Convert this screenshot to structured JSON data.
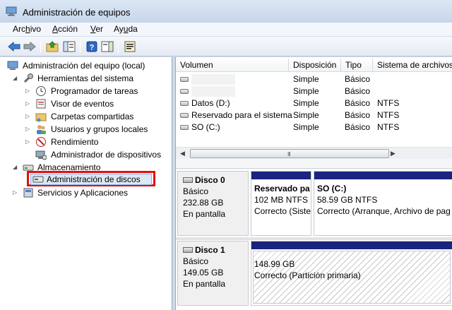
{
  "window": {
    "title": "Administración de equipos"
  },
  "menu": [
    {
      "label": "Archivo",
      "pre": "Arc",
      "u": "h",
      "post": "ivo"
    },
    {
      "label": "Acción",
      "pre": "",
      "u": "A",
      "post": "cción"
    },
    {
      "label": "Ver",
      "pre": "",
      "u": "V",
      "post": "er"
    },
    {
      "label": "Ayuda",
      "pre": "Ay",
      "u": "u",
      "post": "da"
    }
  ],
  "toolbar": {
    "icons": [
      "back-icon",
      "forward-icon",
      "up-folder-icon",
      "show-hide-tree-icon",
      "help-icon",
      "action-pane-icon",
      "properties-icon"
    ]
  },
  "tree": {
    "root": "Administración del equipo (local)",
    "system_tools": "Herramientas del sistema",
    "task_scheduler": "Programador de tareas",
    "event_viewer": "Visor de eventos",
    "shared_folders": "Carpetas compartidas",
    "local_users": "Usuarios y grupos locales",
    "performance": "Rendimiento",
    "device_manager": "Administrador de dispositivos",
    "storage": "Almacenamiento",
    "disk_management": "Administración de discos",
    "services": "Servicios y Aplicaciones"
  },
  "volumes": {
    "columns": [
      "Volumen",
      "Disposición",
      "Tipo",
      "Sistema de archivos"
    ],
    "rows": [
      {
        "name": "",
        "layout": "Simple",
        "type": "Básico",
        "fs": ""
      },
      {
        "name": "",
        "layout": "Simple",
        "type": "Básico",
        "fs": ""
      },
      {
        "name": "Datos (D:)",
        "layout": "Simple",
        "type": "Básico",
        "fs": "NTFS"
      },
      {
        "name": "Reservado para el sistema",
        "layout": "Simple",
        "type": "Básico",
        "fs": "NTFS"
      },
      {
        "name": "SO (C:)",
        "layout": "Simple",
        "type": "Básico",
        "fs": "NTFS"
      }
    ],
    "scroll_grip": "III"
  },
  "disks": [
    {
      "name": "Disco 0",
      "kind": "Básico",
      "size": "232.88 GB",
      "status": "En pantalla",
      "partitions": [
        {
          "name": "Reservado pa",
          "size": "102 MB NTFS",
          "status": "Correcto (Siste"
        },
        {
          "name": "SO  (C:)",
          "size": "58.59 GB NTFS",
          "status": "Correcto (Arranque, Archivo de pag"
        }
      ]
    },
    {
      "name": "Disco 1",
      "kind": "Básico",
      "size": "149.05 GB",
      "status": "En pantalla",
      "partitions": [
        {
          "name": "",
          "size": "148.99 GB",
          "status": "Correcto (Partición primaria)"
        }
      ]
    }
  ],
  "colors": {
    "partition_bar": "#1a237e",
    "highlight_box": "#e01010",
    "selection": "#dce8f6"
  }
}
